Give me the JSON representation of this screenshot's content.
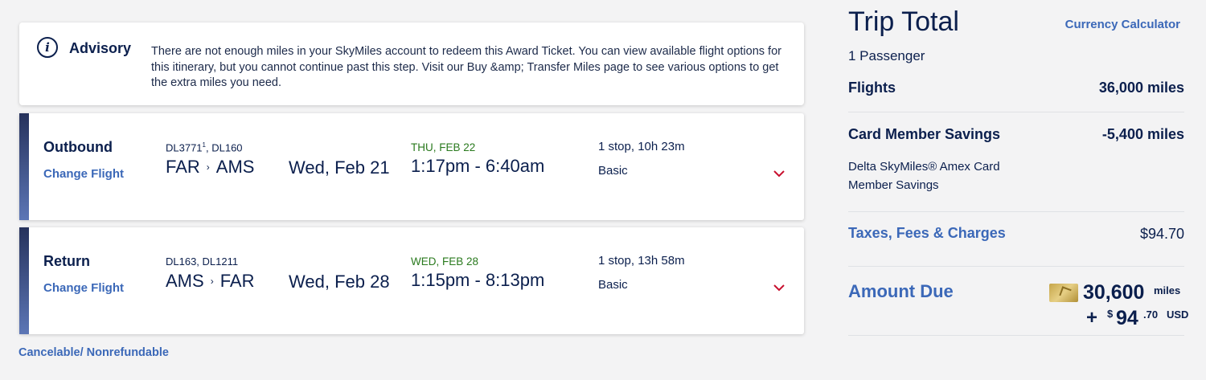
{
  "advisory": {
    "title": "Advisory",
    "text": "There are not enough miles in your SkyMiles account to redeem this Award Ticket. You can view available flight options for this itinerary, but you cannot continue past this step. Visit our Buy &amp; Transfer Miles page to see various options to get the extra miles you need.",
    "icon": "info-icon"
  },
  "outbound": {
    "label": "Outbound",
    "change": "Change Flight",
    "flight_main": "DL3771",
    "flight_sup": "1",
    "flight_rest": ", DL160",
    "origin": "FAR",
    "destination": "AMS",
    "date": "Wed, Feb 21",
    "arrival_date": "THU, FEB 22",
    "time": "1:17pm - 6:40am",
    "stops": "1 stop, 10h 23m",
    "fare_class": "Basic"
  },
  "return": {
    "label": "Return",
    "change": "Change Flight",
    "flights": "DL163, DL1211",
    "origin": "AMS",
    "destination": "FAR",
    "date": "Wed, Feb 28",
    "arrival_date": "WED, FEB 28",
    "time": "1:15pm - 8:13pm",
    "stops": "1 stop, 13h 58m",
    "fare_class": "Basic"
  },
  "route_arrow": "›",
  "cancel_note": "Cancelable/ Nonrefundable",
  "trip_total": {
    "title": "Trip Total",
    "currency_calculator": "Currency Calculator",
    "passengers": "1 Passenger",
    "flights_label": "Flights",
    "flights_value": "36,000 miles",
    "savings_label": "Card Member Savings",
    "savings_value": "-5,400 miles",
    "savings_desc_1": "Delta SkyMiles® Amex Card",
    "savings_desc_2": "Member Savings",
    "taxes_label": "Taxes, Fees & Charges",
    "taxes_value": "$94.70",
    "amount_due_label": "Amount Due",
    "due_miles": "30,600",
    "due_miles_unit": "miles",
    "due_plus": "+",
    "due_currency_symbol": "$",
    "due_usd_whole": "94",
    "due_usd_cents": ".70",
    "due_currency": "USD"
  },
  "colors": {
    "navy": "#0b1f4d",
    "link_blue": "#3b68b8",
    "green": "#2a7a1e",
    "chevron_red": "#c8102e"
  }
}
